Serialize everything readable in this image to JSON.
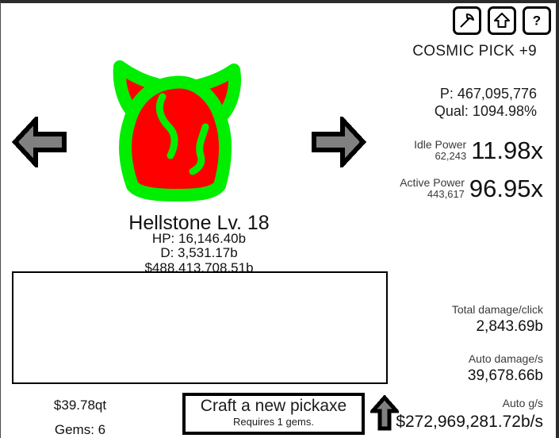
{
  "window": {
    "background": "#ffffff",
    "border_color": "#2b2b2b"
  },
  "toolbar": {
    "icons": [
      {
        "name": "pickaxe-icon",
        "label": "Pickaxe"
      },
      {
        "name": "upgrade-arrow-icon",
        "label": "Upgrade"
      },
      {
        "name": "help-question-icon",
        "label": "Help"
      }
    ]
  },
  "pickaxe": {
    "title": "COSMIC PICK +9",
    "power_line": "P: 467,095,776",
    "quality_line": "Qual: 1094.98%"
  },
  "power": {
    "idle": {
      "label": "Idle Power",
      "value": "62,243",
      "multiplier": "11.98x"
    },
    "active": {
      "label": "Active Power",
      "value": "443,617",
      "multiplier": "96.95x"
    }
  },
  "stats": [
    {
      "label": "Total damage/click",
      "value": "2,843.69b"
    },
    {
      "label": "Auto damage/s",
      "value": "39,678.66b"
    },
    {
      "label": "Auto g/s",
      "value": "$272,969,281.72b/s"
    }
  ],
  "monster": {
    "name": "Hellstone Lv. 18",
    "hp": "HP: 16,146.40b",
    "damage": "D: 3,531.17b",
    "gold": "$488,413,708.51b",
    "sprite_name": "demon-head-sprite",
    "body_color": "#ff0000",
    "outline_color": "#00ee00"
  },
  "navigation": {
    "prev_label": "Previous monster",
    "next_label": "Next monster",
    "arrow_fill": "#808080",
    "arrow_outline": "#000000"
  },
  "log_panel": {
    "content": ""
  },
  "currency": {
    "money": "$39.78qt",
    "gems": "Gems: 6"
  },
  "craft": {
    "main_label": "Craft a new pickaxe",
    "sub_label": "Requires 1 gems.",
    "arrow_name": "craft-upgrade-arrow-icon"
  }
}
